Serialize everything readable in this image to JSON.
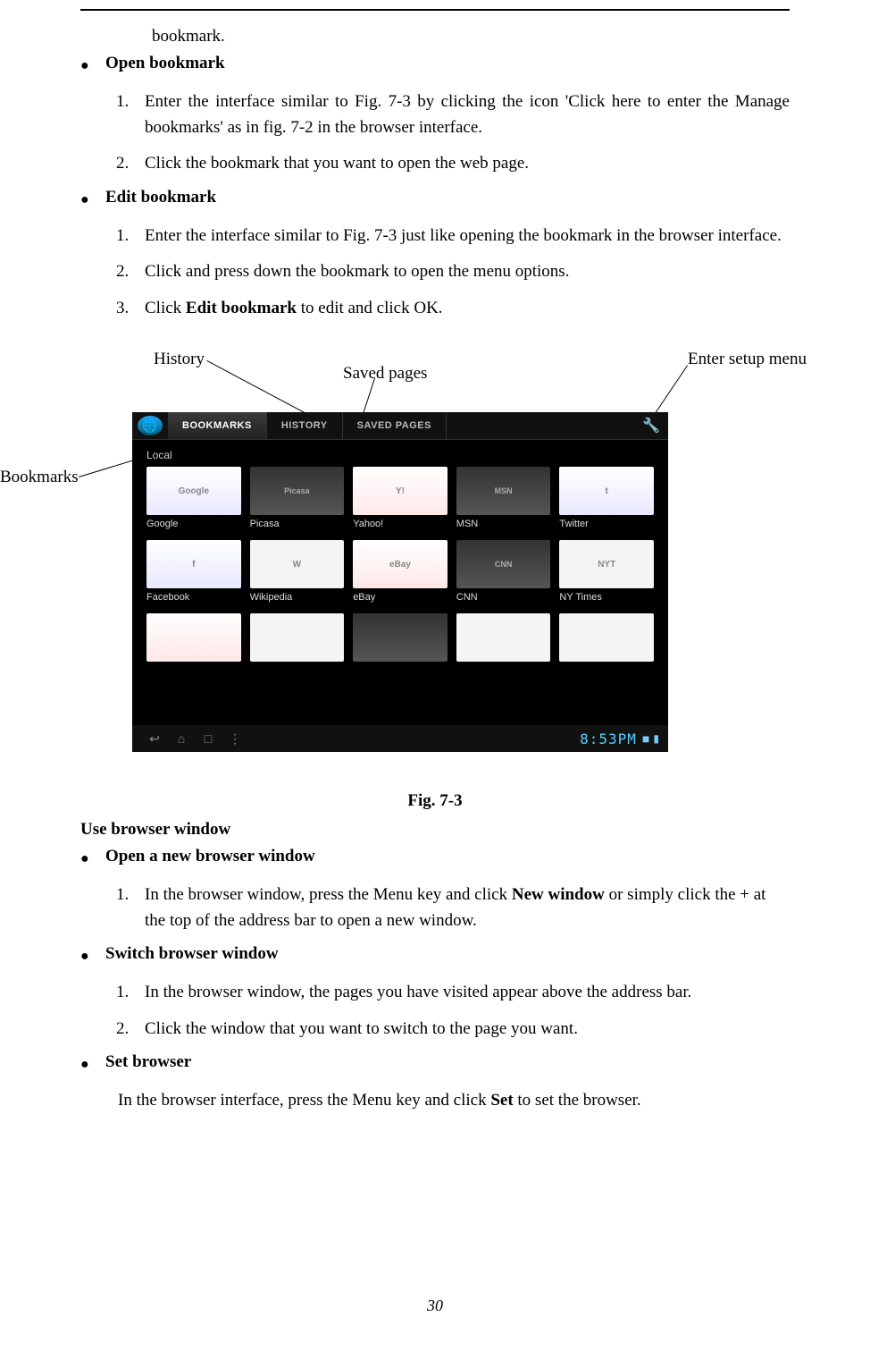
{
  "top_fragment": "bookmark.",
  "sections": {
    "open_bookmark": {
      "title": "Open bookmark",
      "items": [
        "Enter the interface similar to Fig. 7-3 by clicking the icon 'Click here to enter the Manage bookmarks' as in fig. 7-2 in the browser interface.",
        "Click the bookmark that you want to open the web page."
      ]
    },
    "edit_bookmark": {
      "title": "Edit bookmark",
      "items": [
        "Enter the interface similar to Fig. 7-3 just like opening the bookmark in the browser interface.",
        "Click and press down the bookmark to open the menu options."
      ],
      "item3_pre": "Click ",
      "item3_bold": "Edit bookmark",
      "item3_post": " to edit and click OK."
    }
  },
  "callouts": {
    "history": "History",
    "saved_pages": "Saved pages",
    "enter_setup": "Enter setup menu",
    "bookmarks": "Bookmarks"
  },
  "screenshot": {
    "tabs": [
      "BOOKMARKS",
      "HISTORY",
      "SAVED PAGES"
    ],
    "section_label": "Local",
    "thumbs": [
      "Google",
      "Picasa",
      "Yahoo!",
      "MSN",
      "Twitter",
      "Facebook",
      "Wikipedia",
      "eBay",
      "CNN",
      "NY Times"
    ],
    "time": "8:53PM"
  },
  "fig_caption": "Fig. 7-3",
  "use_browser": {
    "heading": "Use browser window",
    "open_new": {
      "title": "Open a new browser window",
      "item1_pre": "In the browser window, press the Menu key and click ",
      "item1_bold": "New window",
      "item1_post": " or simply click the + at the top of the address bar to open a new window."
    },
    "switch": {
      "title": "Switch browser window",
      "items": [
        "In the browser window, the pages you have visited appear above the address bar.",
        "Click the window that you want to switch to the page you want."
      ]
    },
    "set": {
      "title": "Set browser",
      "para_pre": "In the browser interface, press the Menu key and click ",
      "para_bold": "Set",
      "para_post": " to set the browser."
    }
  },
  "page_number": "30"
}
